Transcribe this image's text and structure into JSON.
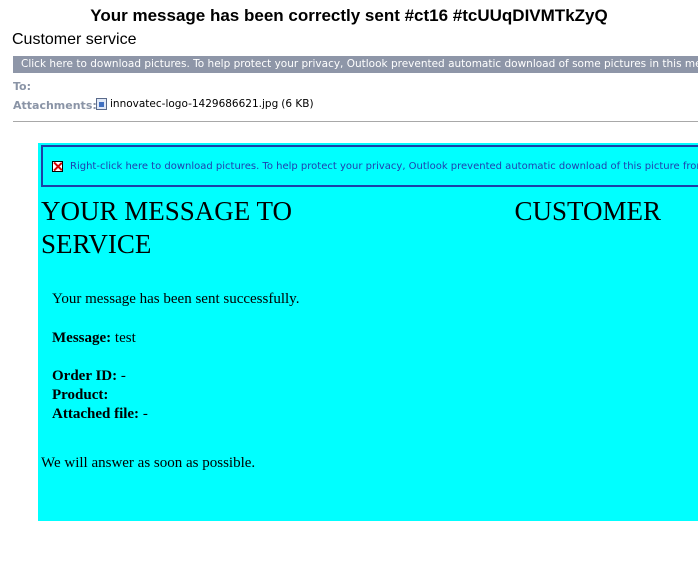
{
  "email": {
    "subject": "Your message has been correctly sent #ct16 #tcUUqDIVMTkZyQ",
    "sender": "Customer service",
    "infobar_text": "Click here to download pictures. To help protect your privacy, Outlook prevented automatic download of some pictures in this message.",
    "to_label": "To:",
    "attachments_label": "Attachments:",
    "attachment": {
      "filename": "innovatec-logo-1429686621.jpg",
      "size": "(6 KB)",
      "icon": "image-file-icon"
    }
  },
  "body": {
    "background_color": "#00ffff",
    "picture_placeholder": {
      "icon": "broken-image-x-icon",
      "text": "Right-click here to download pictures. To help protect your privacy, Outlook prevented automatic download of this picture from the Int"
    },
    "heading_left": "YOUR MESSAGE TO",
    "heading_right": "CUSTOMER",
    "heading_line2": "SERVICE",
    "success_text": "Your message has been sent successfully.",
    "message_label": "Message:",
    "message_value": "test",
    "order_label": "Order ID:",
    "order_value": "-",
    "product_label": "Product:",
    "product_value": "",
    "attached_label": "Attached file:",
    "attached_value": "-",
    "closing_text": "We will answer as soon as possible."
  }
}
